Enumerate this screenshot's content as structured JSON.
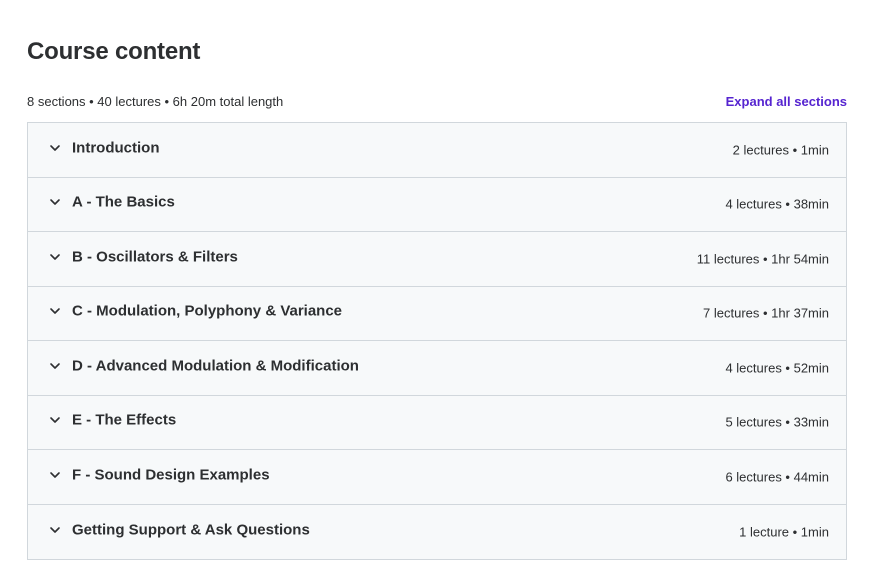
{
  "header": {
    "title": "Course content",
    "meta": "8 sections • 40 lectures • 6h 20m total length",
    "expand_label": "Expand all sections"
  },
  "sections": [
    {
      "title": "Introduction",
      "info": "2 lectures • 1min"
    },
    {
      "title": "A - The Basics",
      "info": "4 lectures • 38min"
    },
    {
      "title": "B - Oscillators & Filters",
      "info": "11 lectures • 1hr 54min"
    },
    {
      "title": "C - Modulation, Polyphony & Variance",
      "info": "7 lectures • 1hr 37min"
    },
    {
      "title": "D - Advanced Modulation & Modification",
      "info": "4 lectures • 52min"
    },
    {
      "title": "E - The Effects",
      "info": "5 lectures • 33min"
    },
    {
      "title": "F - Sound Design Examples",
      "info": "6 lectures • 44min"
    },
    {
      "title": "Getting Support & Ask Questions",
      "info": "1 lecture • 1min"
    }
  ],
  "icons": {
    "chevron": "chevron-down-icon"
  },
  "colors": {
    "text": "#2d2f31",
    "link": "#5624d0",
    "section_bg": "#f7f9fa",
    "border": "#d1d7dc"
  }
}
